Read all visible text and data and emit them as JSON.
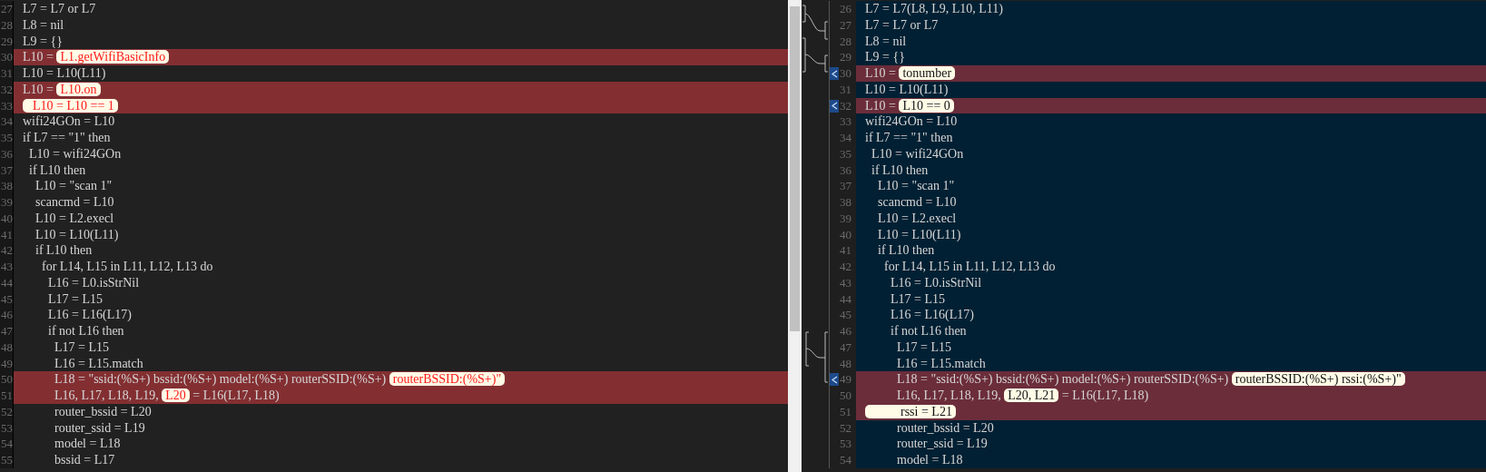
{
  "left_pane": {
    "lines": [
      {
        "number": "27",
        "changed": false,
        "segments": [
          {
            "text": "L7 = L7 or L7",
            "highlight": false
          }
        ]
      },
      {
        "number": "28",
        "changed": false,
        "segments": [
          {
            "text": "L8 = nil",
            "highlight": false
          }
        ]
      },
      {
        "number": "29",
        "changed": false,
        "segments": [
          {
            "text": "L9 = {}",
            "highlight": false
          }
        ]
      },
      {
        "number": "30",
        "changed": true,
        "segments": [
          {
            "text": "L10 = ",
            "highlight": false
          },
          {
            "text": "L1.getWifiBasicInfo",
            "highlight": true
          }
        ]
      },
      {
        "number": "31",
        "changed": false,
        "segments": [
          {
            "text": "L10 = L10(L11)",
            "highlight": false
          }
        ]
      },
      {
        "number": "32",
        "changed": true,
        "segments": [
          {
            "text": "L10 = ",
            "highlight": false
          },
          {
            "text": "L10.on",
            "highlight": true
          }
        ]
      },
      {
        "number": "33",
        "changed": true,
        "segments": [
          {
            "text": "  L10 = L10 == 1",
            "highlight": true
          }
        ]
      },
      {
        "number": "34",
        "changed": false,
        "segments": [
          {
            "text": "wifi24GOn = L10",
            "highlight": false
          }
        ]
      },
      {
        "number": "35",
        "changed": false,
        "segments": [
          {
            "text": "if L7 == \"1\" then",
            "highlight": false
          }
        ]
      },
      {
        "number": "36",
        "changed": false,
        "segments": [
          {
            "text": "  L10 = wifi24GOn",
            "highlight": false
          }
        ]
      },
      {
        "number": "37",
        "changed": false,
        "segments": [
          {
            "text": "  if L10 then",
            "highlight": false
          }
        ]
      },
      {
        "number": "38",
        "changed": false,
        "segments": [
          {
            "text": "    L10 = \"scan 1\"",
            "highlight": false
          }
        ]
      },
      {
        "number": "39",
        "changed": false,
        "segments": [
          {
            "text": "    scancmd = L10",
            "highlight": false
          }
        ]
      },
      {
        "number": "40",
        "changed": false,
        "segments": [
          {
            "text": "    L10 = L2.execl",
            "highlight": false
          }
        ]
      },
      {
        "number": "41",
        "changed": false,
        "segments": [
          {
            "text": "    L10 = L10(L11)",
            "highlight": false
          }
        ]
      },
      {
        "number": "42",
        "changed": false,
        "segments": [
          {
            "text": "    if L10 then",
            "highlight": false
          }
        ]
      },
      {
        "number": "43",
        "changed": false,
        "segments": [
          {
            "text": "      for L14, L15 in L11, L12, L13 do",
            "highlight": false
          }
        ]
      },
      {
        "number": "44",
        "changed": false,
        "segments": [
          {
            "text": "        L16 = L0.isStrNil",
            "highlight": false
          }
        ]
      },
      {
        "number": "45",
        "changed": false,
        "segments": [
          {
            "text": "        L17 = L15",
            "highlight": false
          }
        ]
      },
      {
        "number": "46",
        "changed": false,
        "segments": [
          {
            "text": "        L16 = L16(L17)",
            "highlight": false
          }
        ]
      },
      {
        "number": "47",
        "changed": false,
        "segments": [
          {
            "text": "        if not L16 then",
            "highlight": false
          }
        ]
      },
      {
        "number": "48",
        "changed": false,
        "segments": [
          {
            "text": "          L17 = L15",
            "highlight": false
          }
        ]
      },
      {
        "number": "49",
        "changed": false,
        "segments": [
          {
            "text": "          L16 = L15.match",
            "highlight": false
          }
        ]
      },
      {
        "number": "50",
        "changed": true,
        "segments": [
          {
            "text": "          L18 = \"ssid:(%S+) bssid:(%S+) model:(%S+) routerSSID:(%S+) ",
            "highlight": false
          },
          {
            "text": "routerBSSID:(%S+)\"",
            "highlight": true
          }
        ]
      },
      {
        "number": "51",
        "changed": true,
        "segments": [
          {
            "text": "          L16, L17, L18, L19, ",
            "highlight": false
          },
          {
            "text": "L20",
            "highlight": true
          },
          {
            "text": " = L16(L17, L18)",
            "highlight": false
          }
        ]
      },
      {
        "number": "52",
        "changed": false,
        "segments": [
          {
            "text": "          router_bssid = L20",
            "highlight": false
          }
        ]
      },
      {
        "number": "53",
        "changed": false,
        "segments": [
          {
            "text": "          router_ssid = L19",
            "highlight": false
          }
        ]
      },
      {
        "number": "54",
        "changed": false,
        "segments": [
          {
            "text": "          model = L18",
            "highlight": false
          }
        ]
      },
      {
        "number": "55",
        "changed": false,
        "segments": [
          {
            "text": "          bssid = L17",
            "highlight": false
          }
        ]
      }
    ]
  },
  "right_pane": {
    "lines": [
      {
        "number": "26",
        "changed": false,
        "merge_arrow": false,
        "segments": [
          {
            "text": "L7 = L7(L8, L9, L10, L11)",
            "highlight": false
          }
        ]
      },
      {
        "number": "27",
        "changed": false,
        "merge_arrow": false,
        "segments": [
          {
            "text": "L7 = L7 or L7",
            "highlight": false
          }
        ]
      },
      {
        "number": "28",
        "changed": false,
        "merge_arrow": false,
        "segments": [
          {
            "text": "L8 = nil",
            "highlight": false
          }
        ]
      },
      {
        "number": "29",
        "changed": false,
        "merge_arrow": false,
        "segments": [
          {
            "text": "L9 = {}",
            "highlight": false
          }
        ]
      },
      {
        "number": "30",
        "changed": true,
        "merge_arrow": true,
        "segments": [
          {
            "text": "L10 = ",
            "highlight": false
          },
          {
            "text": "tonumber",
            "highlight": true
          }
        ]
      },
      {
        "number": "31",
        "changed": false,
        "merge_arrow": false,
        "segments": [
          {
            "text": "L10 = L10(L11)",
            "highlight": false
          }
        ]
      },
      {
        "number": "32",
        "changed": true,
        "merge_arrow": true,
        "segments": [
          {
            "text": "L10 = ",
            "highlight": false
          },
          {
            "text": "L10 == 0",
            "highlight": true
          }
        ]
      },
      {
        "number": "33",
        "changed": false,
        "merge_arrow": false,
        "segments": [
          {
            "text": "wifi24GOn = L10",
            "highlight": false
          }
        ]
      },
      {
        "number": "34",
        "changed": false,
        "merge_arrow": false,
        "segments": [
          {
            "text": "if L7 == \"1\" then",
            "highlight": false
          }
        ]
      },
      {
        "number": "35",
        "changed": false,
        "merge_arrow": false,
        "segments": [
          {
            "text": "  L10 = wifi24GOn",
            "highlight": false
          }
        ]
      },
      {
        "number": "36",
        "changed": false,
        "merge_arrow": false,
        "segments": [
          {
            "text": "  if L10 then",
            "highlight": false
          }
        ]
      },
      {
        "number": "37",
        "changed": false,
        "merge_arrow": false,
        "segments": [
          {
            "text": "    L10 = \"scan 1\"",
            "highlight": false
          }
        ]
      },
      {
        "number": "38",
        "changed": false,
        "merge_arrow": false,
        "segments": [
          {
            "text": "    scancmd = L10",
            "highlight": false
          }
        ]
      },
      {
        "number": "39",
        "changed": false,
        "merge_arrow": false,
        "segments": [
          {
            "text": "    L10 = L2.execl",
            "highlight": false
          }
        ]
      },
      {
        "number": "40",
        "changed": false,
        "merge_arrow": false,
        "segments": [
          {
            "text": "    L10 = L10(L11)",
            "highlight": false
          }
        ]
      },
      {
        "number": "41",
        "changed": false,
        "merge_arrow": false,
        "segments": [
          {
            "text": "    if L10 then",
            "highlight": false
          }
        ]
      },
      {
        "number": "42",
        "changed": false,
        "merge_arrow": false,
        "segments": [
          {
            "text": "      for L14, L15 in L11, L12, L13 do",
            "highlight": false
          }
        ]
      },
      {
        "number": "43",
        "changed": false,
        "merge_arrow": false,
        "segments": [
          {
            "text": "        L16 = L0.isStrNil",
            "highlight": false
          }
        ]
      },
      {
        "number": "44",
        "changed": false,
        "merge_arrow": false,
        "segments": [
          {
            "text": "        L17 = L15",
            "highlight": false
          }
        ]
      },
      {
        "number": "45",
        "changed": false,
        "merge_arrow": false,
        "segments": [
          {
            "text": "        L16 = L16(L17)",
            "highlight": false
          }
        ]
      },
      {
        "number": "46",
        "changed": false,
        "merge_arrow": false,
        "segments": [
          {
            "text": "        if not L16 then",
            "highlight": false
          }
        ]
      },
      {
        "number": "47",
        "changed": false,
        "merge_arrow": false,
        "segments": [
          {
            "text": "          L17 = L15",
            "highlight": false
          }
        ]
      },
      {
        "number": "48",
        "changed": false,
        "merge_arrow": false,
        "segments": [
          {
            "text": "          L16 = L15.match",
            "highlight": false
          }
        ]
      },
      {
        "number": "49",
        "changed": true,
        "merge_arrow": true,
        "segments": [
          {
            "text": "          L18 = \"ssid:(%S+) bssid:(%S+) model:(%S+) routerSSID:(%S+) ",
            "highlight": false
          },
          {
            "text": "routerBSSID:(%S+) rssi:(%S+)\"",
            "highlight": true
          }
        ]
      },
      {
        "number": "50",
        "changed": true,
        "merge_arrow": false,
        "segments": [
          {
            "text": "          L16, L17, L18, L19, ",
            "highlight": false
          },
          {
            "text": "L20, L21",
            "highlight": true
          },
          {
            "text": " = L16(L17, L18)",
            "highlight": false
          }
        ]
      },
      {
        "number": "51",
        "changed": true,
        "merge_arrow": false,
        "segments": [
          {
            "text": "          rssi = L21",
            "highlight": true
          }
        ]
      },
      {
        "number": "52",
        "changed": false,
        "merge_arrow": false,
        "segments": [
          {
            "text": "          router_bssid = L20",
            "highlight": false
          }
        ]
      },
      {
        "number": "53",
        "changed": false,
        "merge_arrow": false,
        "segments": [
          {
            "text": "          router_ssid = L19",
            "highlight": false
          }
        ]
      },
      {
        "number": "54",
        "changed": false,
        "merge_arrow": false,
        "segments": [
          {
            "text": "          model = L18",
            "highlight": false
          }
        ]
      }
    ]
  }
}
